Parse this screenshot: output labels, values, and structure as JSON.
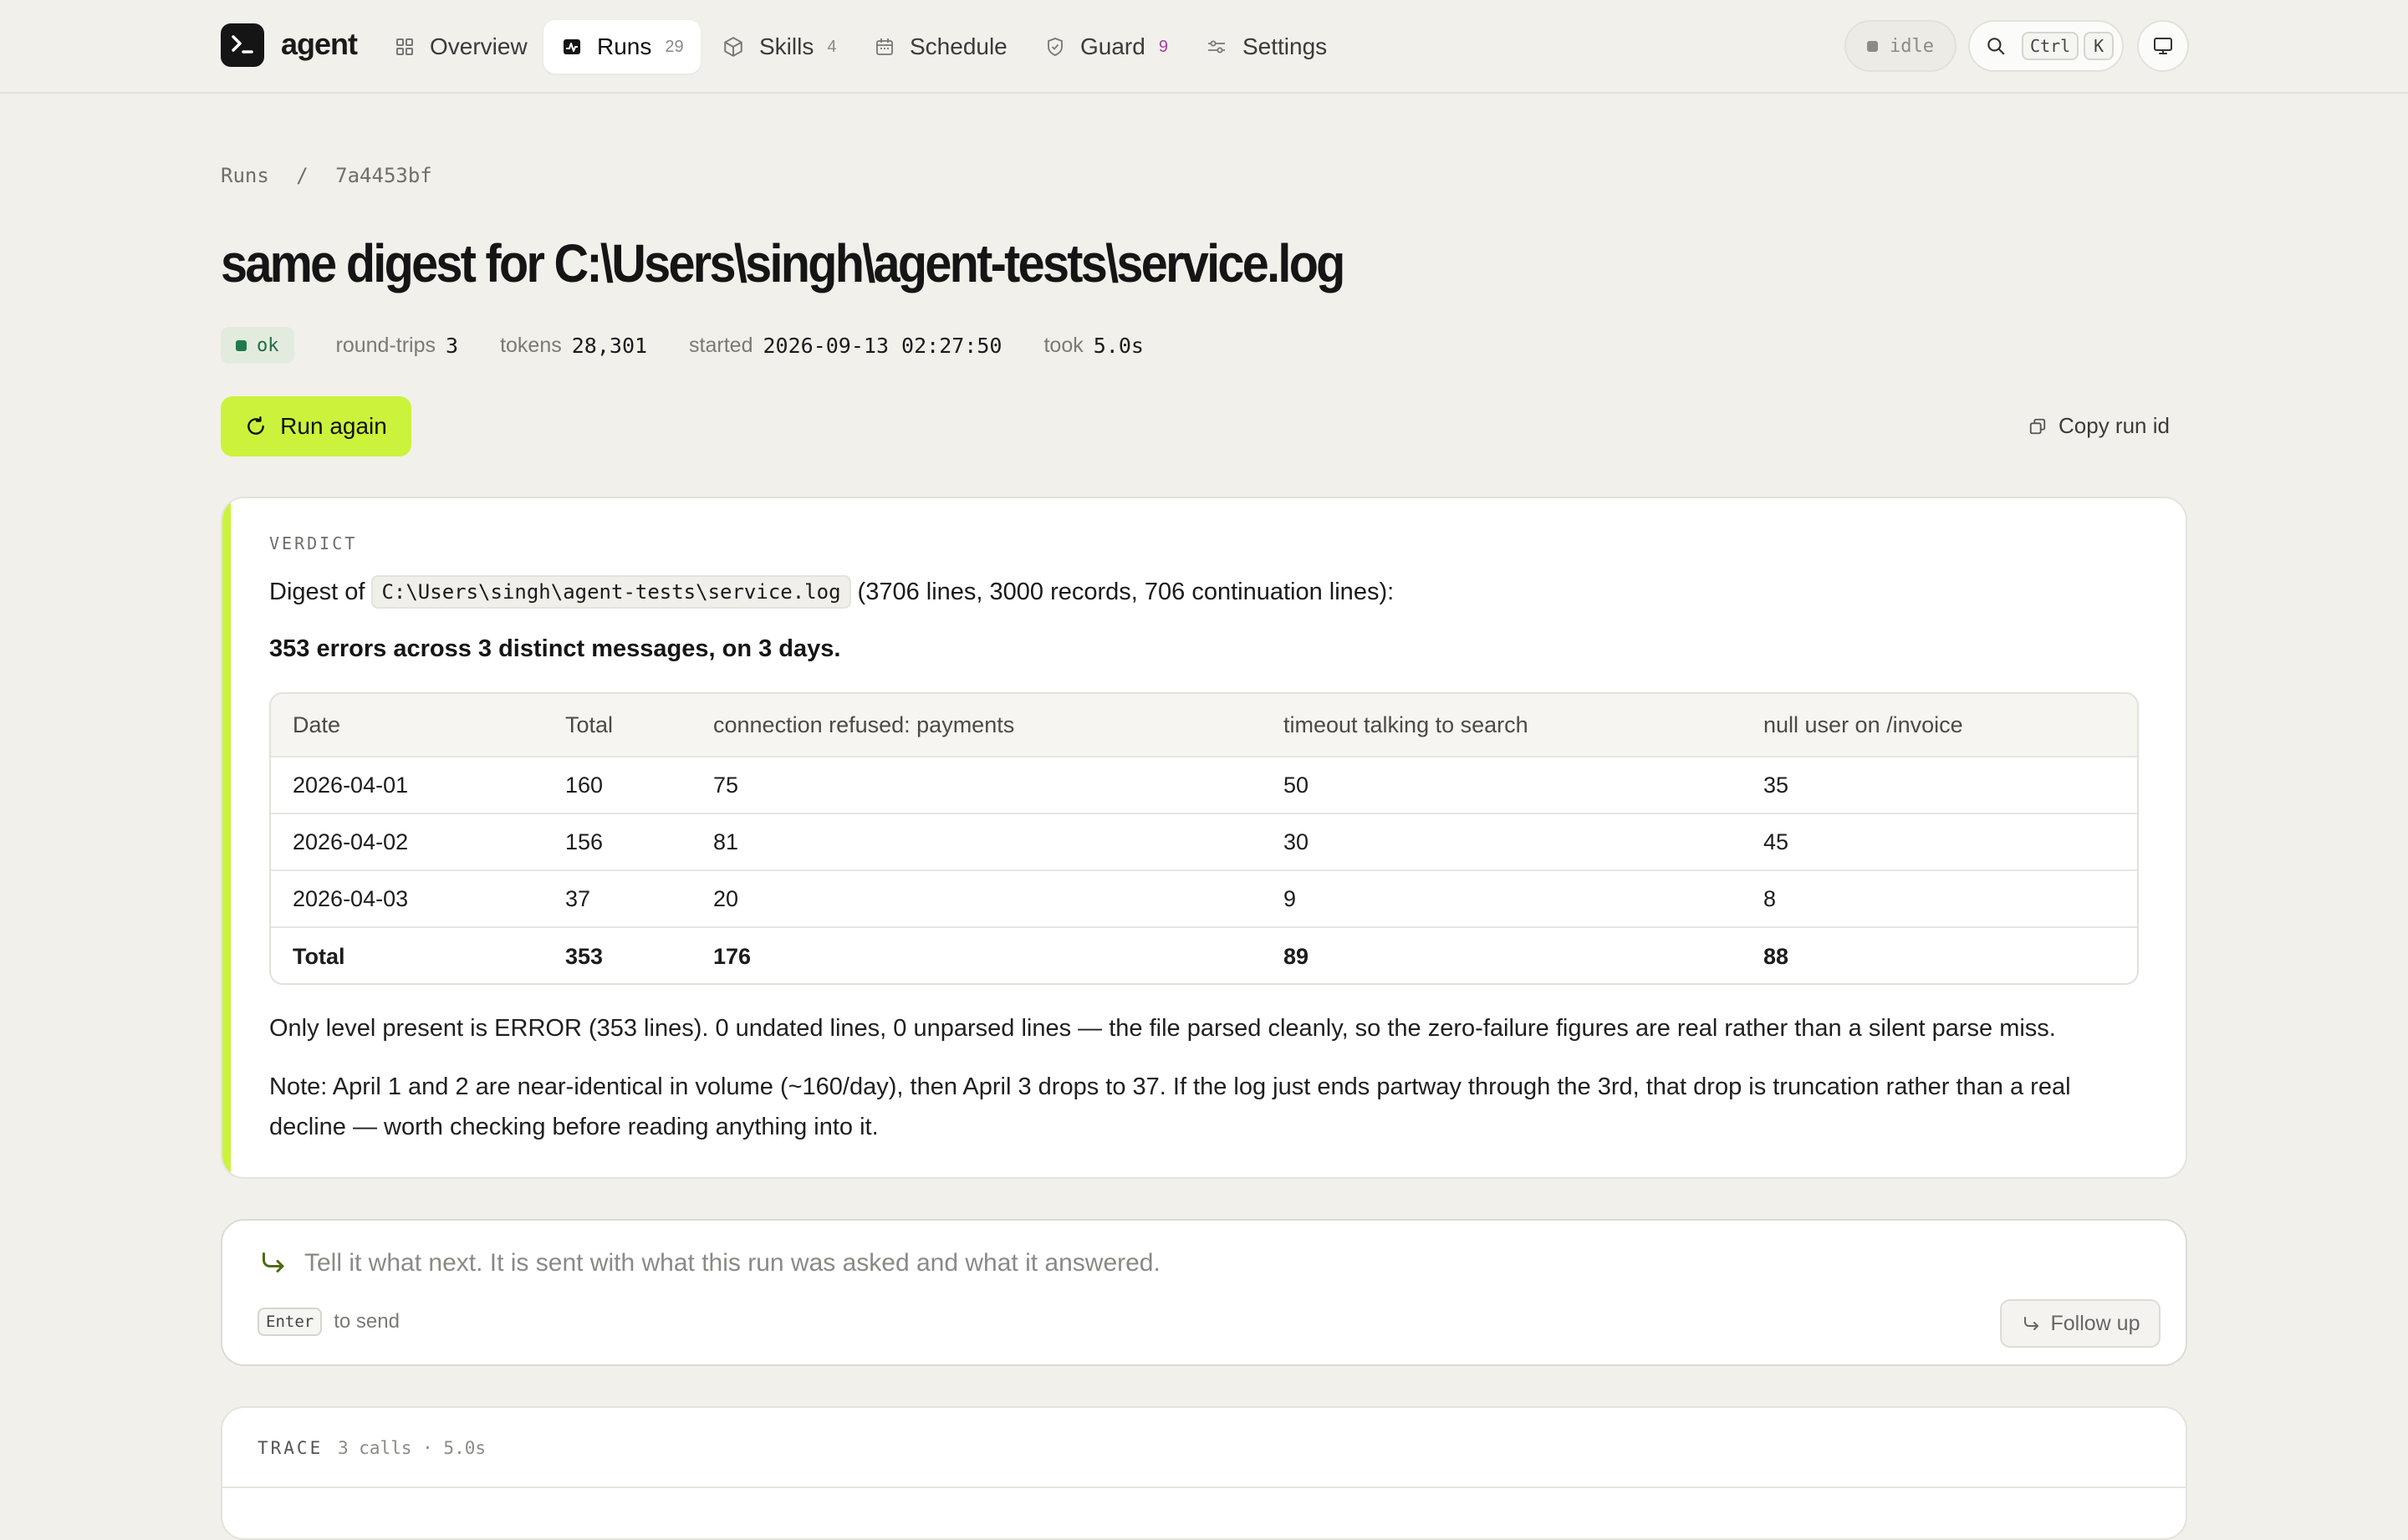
{
  "nav": {
    "brand": "agent",
    "items": [
      {
        "label": "Overview",
        "count": "",
        "icon": "grid-icon"
      },
      {
        "label": "Runs",
        "count": "29",
        "icon": "activity-icon",
        "active": true
      },
      {
        "label": "Skills",
        "count": "4",
        "icon": "cube-icon"
      },
      {
        "label": "Schedule",
        "count": "",
        "icon": "calendar-icon"
      },
      {
        "label": "Guard",
        "count": "9",
        "icon": "shield-icon"
      },
      {
        "label": "Settings",
        "count": "",
        "icon": "sliders-icon"
      }
    ],
    "status": "idle",
    "search_kbd": [
      "Ctrl",
      "K"
    ]
  },
  "breadcrumb": {
    "root": "Runs",
    "sep": "/",
    "current": "7a4453bf"
  },
  "run": {
    "title": "same digest for C:\\Users\\singh\\agent-tests\\service.log",
    "status": "ok",
    "round_trips_label": "round-trips",
    "round_trips": "3",
    "tokens_label": "tokens",
    "tokens": "28,301",
    "started_label": "started",
    "started": "2026-09-13 02:27:50",
    "took_label": "took",
    "took": "5.0s",
    "run_again": "Run again",
    "copy_run_id": "Copy run id"
  },
  "verdict": {
    "label": "VERDICT",
    "intro_prefix": "Digest of",
    "path": "C:\\Users\\singh\\agent-tests\\service.log",
    "intro_suffix": "(3706 lines, 3000 records, 706 continuation lines):",
    "summary": "353 errors across 3 distinct messages, on 3 days.",
    "table": {
      "headers": [
        "Date",
        "Total",
        "connection refused: payments",
        "timeout talking to search",
        "null user on /invoice"
      ],
      "rows": [
        [
          "2026-04-01",
          "160",
          "75",
          "50",
          "35"
        ],
        [
          "2026-04-02",
          "156",
          "81",
          "30",
          "45"
        ],
        [
          "2026-04-03",
          "37",
          "20",
          "9",
          "8"
        ]
      ],
      "total": [
        "Total",
        "353",
        "176",
        "89",
        "88"
      ]
    },
    "para1": "Only level present is ERROR (353 lines). 0 undated lines, 0 unparsed lines — the file parsed cleanly, so the zero-failure figures are real rather than a silent parse miss.",
    "para2": "Note: April 1 and 2 are near-identical in volume (~160/day), then April 3 drops to 37. If the log just ends partway through the 3rd, that drop is truncation rather than a real decline — worth checking before reading anything into it."
  },
  "followup": {
    "placeholder": "Tell it what next. It is sent with what this run was asked and what it answered.",
    "enter_key": "Enter",
    "enter_hint": "to send",
    "button": "Follow up"
  },
  "trace": {
    "label": "TRACE",
    "meta": "3 calls · 5.0s"
  },
  "colors": {
    "accent": "#cbf33c",
    "background": "#f1f0eb",
    "ok": "#1f7a4c",
    "guard_count": "#a43ea0"
  }
}
